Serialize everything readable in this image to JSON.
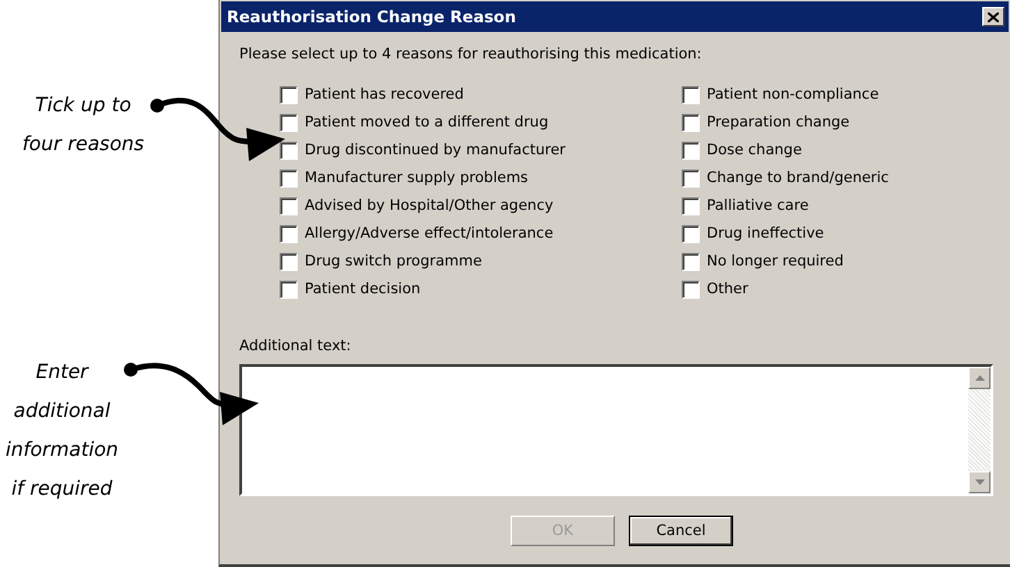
{
  "window": {
    "title": "Reauthorisation Change Reason"
  },
  "instruction": "Please select up to 4 reasons for reauthorising this medication:",
  "reason_columns": [
    {
      "reasons": [
        {
          "label": "Patient has recovered",
          "checked": false
        },
        {
          "label": "Patient moved to a different drug",
          "checked": false
        },
        {
          "label": "Drug discontinued by manufacturer",
          "checked": false
        },
        {
          "label": "Manufacturer supply problems",
          "checked": false
        },
        {
          "label": "Advised by Hospital/Other agency",
          "checked": false
        },
        {
          "label": "Allergy/Adverse effect/intolerance",
          "checked": false
        },
        {
          "label": "Drug switch programme",
          "checked": false
        },
        {
          "label": "Patient decision",
          "checked": false
        }
      ]
    },
    {
      "reasons": [
        {
          "label": "Patient non-compliance",
          "checked": false
        },
        {
          "label": "Preparation change",
          "checked": false
        },
        {
          "label": "Dose change",
          "checked": false
        },
        {
          "label": "Change to brand/generic",
          "checked": false
        },
        {
          "label": "Palliative care",
          "checked": false
        },
        {
          "label": "Drug ineffective",
          "checked": false
        },
        {
          "label": "No longer required",
          "checked": false
        },
        {
          "label": "Other",
          "checked": false
        }
      ]
    }
  ],
  "additional_text": {
    "label": "Additional text:"
  },
  "buttons": [
    {
      "label": "OK",
      "disabled": true
    },
    {
      "label": "Cancel",
      "disabled": false
    }
  ],
  "annotations": [
    {
      "lines": [
        "Tick up to",
        "four reasons"
      ]
    },
    {
      "lines": [
        "Enter",
        "additional",
        "information",
        "if required"
      ]
    }
  ]
}
